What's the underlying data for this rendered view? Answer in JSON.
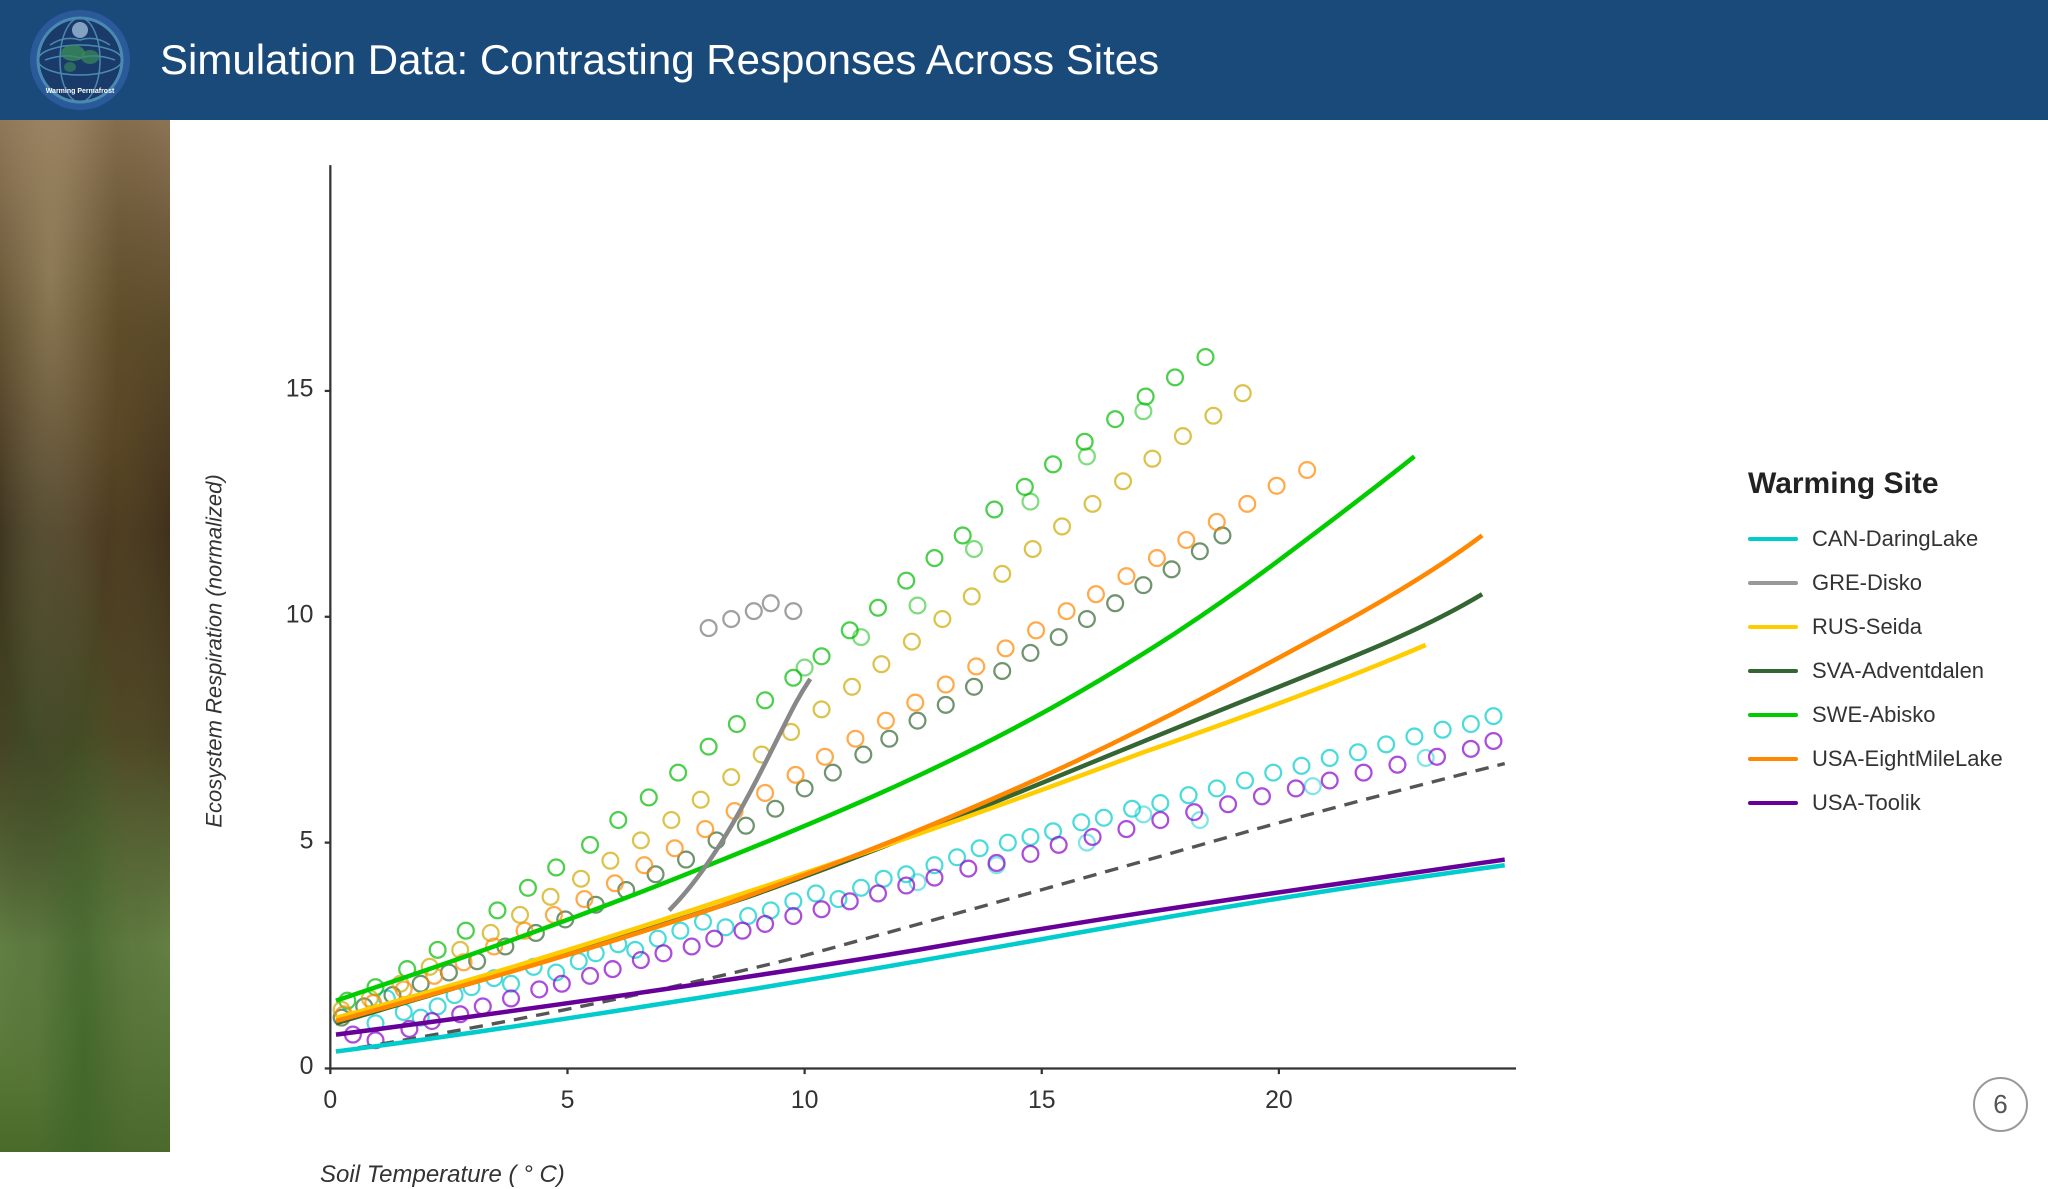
{
  "header": {
    "title": "Simulation Data: Contrasting Responses Across Sites",
    "logo_alt": "Warming Permafrost Model Intercomparison Project"
  },
  "chart": {
    "y_axis_label": "Ecosystem Respiration (normalized)",
    "x_axis_label": "Soil Temperature ( ° C)",
    "x_ticks": [
      "0",
      "5",
      "10",
      "15",
      "20"
    ],
    "y_ticks": [
      "0",
      "5",
      "10",
      "15"
    ],
    "legend_title": "Warming Site"
  },
  "legend": {
    "items": [
      {
        "label": "CAN-DaringLake",
        "color": "#00CCCC"
      },
      {
        "label": "GRE-Disko",
        "color": "#999999"
      },
      {
        "label": "RUS-Seida",
        "color": "#FFCC00"
      },
      {
        "label": "SVA-Adventdalen",
        "color": "#336633"
      },
      {
        "label": "SWE-Abisko",
        "color": "#00CC00"
      },
      {
        "label": "USA-EightMileLake",
        "color": "#FF8800"
      },
      {
        "label": "USA-Toolik",
        "color": "#660099"
      }
    ]
  },
  "slide": {
    "number": "6"
  }
}
